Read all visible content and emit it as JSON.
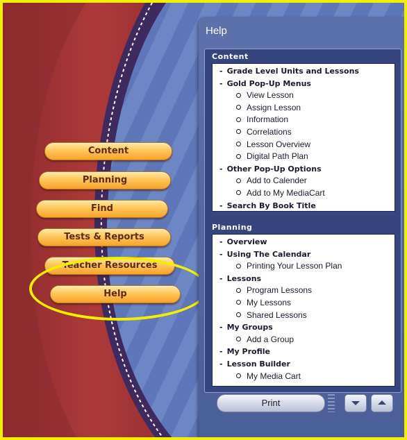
{
  "nav": {
    "content": "Content",
    "planning": "Planning",
    "find": "Find",
    "tests": "Tests & Reports",
    "teacher": "Teacher Resources",
    "help": "Help"
  },
  "help_window": {
    "title": "Help",
    "content_header": "Content",
    "planning_header": "Planning",
    "content_items": [
      {
        "label": "Grade Level Units and Lessons",
        "level": 1
      },
      {
        "label": "Gold Pop-Up Menus",
        "level": 1
      },
      {
        "label": "View Lesson",
        "level": 2
      },
      {
        "label": "Assign Lesson",
        "level": 2
      },
      {
        "label": "Information",
        "level": 2
      },
      {
        "label": "Correlations",
        "level": 2
      },
      {
        "label": "Lesson Overview",
        "level": 2
      },
      {
        "label": "Digital Path Plan",
        "level": 2
      },
      {
        "label": "Other Pop-Up Options",
        "level": 1
      },
      {
        "label": "Add to Calender",
        "level": 2
      },
      {
        "label": "Add to My MediaCart",
        "level": 2
      },
      {
        "label": "Search By Book Title",
        "level": 1
      }
    ],
    "planning_items": [
      {
        "label": "Overview",
        "level": 1
      },
      {
        "label": "Using The Calendar",
        "level": 1
      },
      {
        "label": "Printing Your Lesson Plan",
        "level": 2
      },
      {
        "label": "Lessons",
        "level": 1
      },
      {
        "label": "Program Lessons",
        "level": 2
      },
      {
        "label": "My Lessons",
        "level": 2
      },
      {
        "label": "Shared Lessons",
        "level": 2
      },
      {
        "label": "My Groups",
        "level": 1
      },
      {
        "label": "Add a Group",
        "level": 2
      },
      {
        "label": "My Profile",
        "level": 1
      },
      {
        "label": "Lesson Builder",
        "level": 1
      },
      {
        "label": "My Media Cart",
        "level": 2
      }
    ],
    "print_label": "Print"
  },
  "colors": {
    "highlight": "#f4ee00",
    "button_gold": "#ffc65a",
    "panel_blue": "#4a5e98",
    "swoosh_red": "#a23436"
  }
}
